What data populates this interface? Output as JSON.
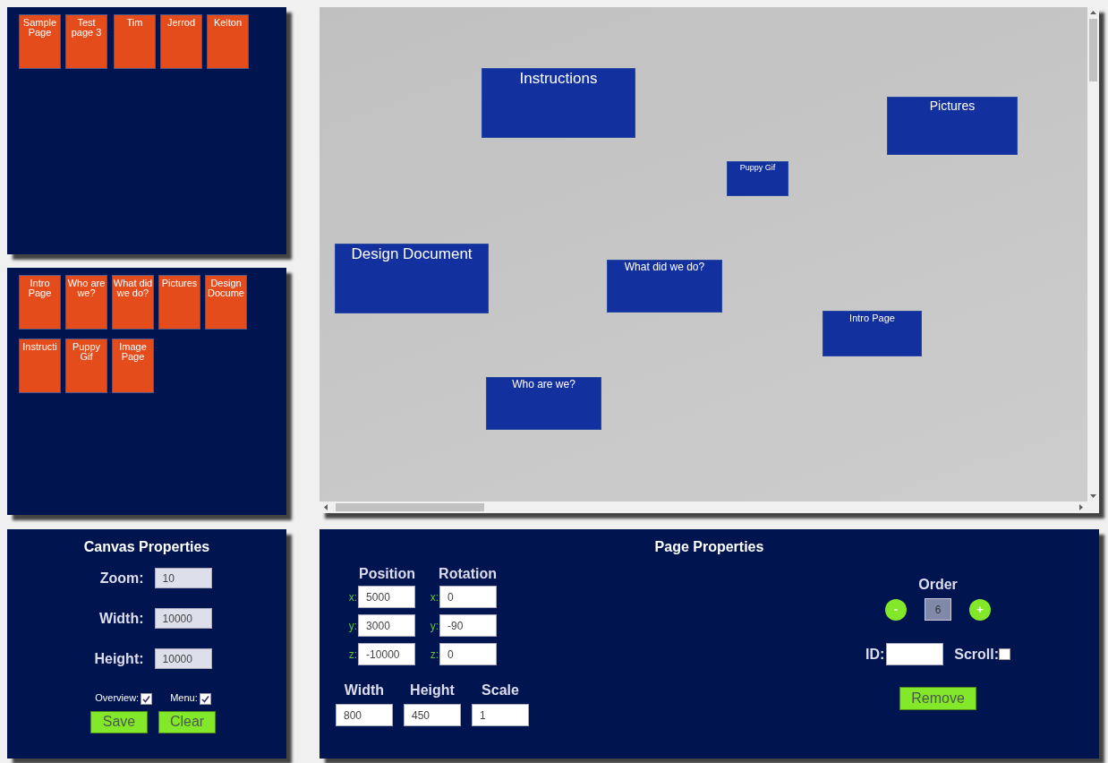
{
  "top_panel": {
    "thumbnails": [
      "Sample Page",
      "Test page 3",
      "Tim",
      "Jerrod",
      "Kelton"
    ]
  },
  "pages_panel": {
    "thumbnails": [
      "Intro Page",
      "Who are we?",
      "What did we do?",
      "Pictures",
      "Design Docume",
      "Instructi",
      "Puppy Gif",
      "Image Page"
    ]
  },
  "canvas": {
    "pages": [
      "Instructions",
      "Pictures",
      "Puppy Gif",
      "Design Document",
      "What did we do?",
      "Intro Page",
      "Who are we?"
    ]
  },
  "canvas_properties": {
    "title": "Canvas Properties",
    "fields": [
      {
        "label": "Zoom:",
        "value": "10"
      },
      {
        "label": "Width:",
        "value": "10000"
      },
      {
        "label": "Height:",
        "value": "10000"
      }
    ],
    "checkboxes": [
      {
        "label": "Overview:",
        "checked": true
      },
      {
        "label": "Menu:",
        "checked": true
      }
    ],
    "buttons": [
      "Save",
      "Clear"
    ]
  },
  "page_properties": {
    "title": "Page Properties",
    "position": {
      "heading": "Position",
      "fields": [
        {
          "label": "x:",
          "value": "5000"
        },
        {
          "label": "y:",
          "value": "3000"
        },
        {
          "label": "z:",
          "value": "-10000"
        }
      ]
    },
    "rotation": {
      "heading": "Rotation",
      "fields": [
        {
          "label": "x:",
          "value": "0"
        },
        {
          "label": "y:",
          "value": "-90"
        },
        {
          "label": "z:",
          "value": "0"
        }
      ]
    },
    "size_fields": [
      {
        "label": "Width",
        "value": "800"
      },
      {
        "label": "Height",
        "value": "450"
      },
      {
        "label": "Scale",
        "value": "1"
      }
    ],
    "order": {
      "heading": "Order",
      "decrement": "-",
      "value": "6",
      "increment": "+"
    },
    "id_field": {
      "label": "ID:"
    },
    "scroll": {
      "label": "Scroll:",
      "checked": false
    },
    "remove_button": "Remove"
  }
}
